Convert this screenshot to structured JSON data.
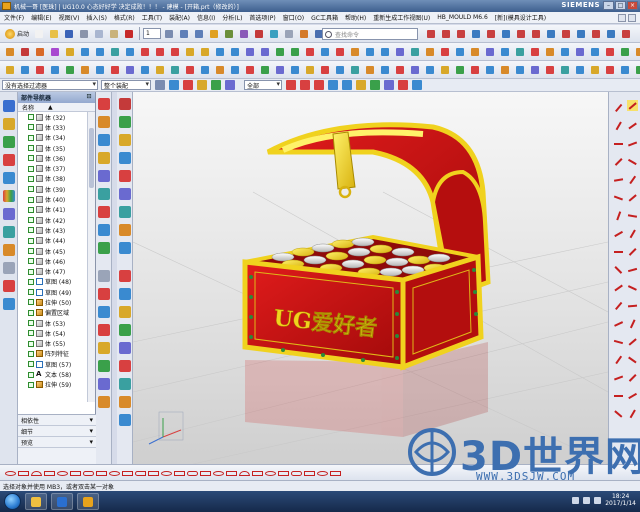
{
  "window": {
    "title": "机械一哥 [医珠] | UG10.0 心态好好学 决定成败！！！ - 建模 - [开箱.prt（修改的）]",
    "brand": "SIEMENS"
  },
  "menu": {
    "items": [
      "文件(F)",
      "编辑(E)",
      "视图(V)",
      "插入(S)",
      "格式(R)",
      "工具(T)",
      "装配(A)",
      "信息(I)",
      "分析(L)",
      "首选项(P)",
      "窗口(O)",
      "GC工具箱",
      "帮助(H)",
      "重新生成工作视图(U)",
      "HB_MOULD M6.6",
      "[新](模具设计工具)"
    ]
  },
  "toolbar": {
    "start_label": "启动",
    "layer_value": "1",
    "search_placeholder": "查找命令"
  },
  "selection_bar": {
    "filter_value": "没有选择过滤器",
    "scope_value": "整个装配",
    "snap_value": "全部"
  },
  "navigator": {
    "title": "部件导航器",
    "column_header": "名称",
    "items": [
      {
        "label": "体 (32)",
        "type": "body"
      },
      {
        "label": "体 (33)",
        "type": "body"
      },
      {
        "label": "体 (34)",
        "type": "body"
      },
      {
        "label": "体 (35)",
        "type": "body"
      },
      {
        "label": "体 (36)",
        "type": "body"
      },
      {
        "label": "体 (37)",
        "type": "body"
      },
      {
        "label": "体 (38)",
        "type": "body"
      },
      {
        "label": "体 (39)",
        "type": "body"
      },
      {
        "label": "体 (40)",
        "type": "body"
      },
      {
        "label": "体 (41)",
        "type": "body"
      },
      {
        "label": "体 (42)",
        "type": "body"
      },
      {
        "label": "体 (43)",
        "type": "body"
      },
      {
        "label": "体 (44)",
        "type": "body"
      },
      {
        "label": "体 (45)",
        "type": "body"
      },
      {
        "label": "体 (46)",
        "type": "body"
      },
      {
        "label": "体 (47)",
        "type": "body"
      },
      {
        "label": "草图 (48)",
        "type": "sketch"
      },
      {
        "label": "草图 (49)",
        "type": "sketch"
      },
      {
        "label": "拉伸 (50)",
        "type": "feature"
      },
      {
        "label": "偏置区域",
        "type": "feature"
      },
      {
        "label": "体 (53)",
        "type": "body"
      },
      {
        "label": "体 (54)",
        "type": "body"
      },
      {
        "label": "体 (55)",
        "type": "body"
      },
      {
        "label": "阵列特征",
        "type": "feature"
      },
      {
        "label": "草图 (57)",
        "type": "sketch"
      },
      {
        "label": "文本 (58)",
        "type": "text"
      },
      {
        "label": "拉伸 (59)",
        "type": "feature"
      }
    ],
    "panels": [
      "相依性",
      "细节",
      "预览"
    ]
  },
  "model": {
    "engraving": "UG爱好者"
  },
  "watermark": {
    "text": "3D世界网",
    "url": "WWW.3DSJW.COM"
  },
  "status": {
    "prompt": "选择对象并使用 MB3，或者双击某一对象"
  },
  "taskbar": {
    "time": "18:24",
    "date": "2017/1/14"
  },
  "colors": {
    "chest_red": "#d41414",
    "chest_gold": "#f0d21e",
    "accent_blue": "#3d6fb0"
  }
}
